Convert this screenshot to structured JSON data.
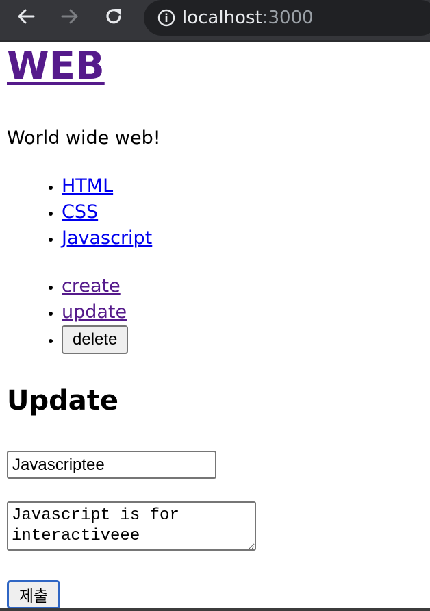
{
  "browser": {
    "url_host": "localhost",
    "url_port": ":3000",
    "icons": {
      "back": "back-arrow-icon",
      "forward": "forward-arrow-icon",
      "reload": "reload-icon",
      "info": "info-icon"
    }
  },
  "site": {
    "title": "WEB",
    "description": "World wide web!"
  },
  "topics": [
    {
      "label": "HTML"
    },
    {
      "label": "CSS"
    },
    {
      "label": "Javascript"
    }
  ],
  "controls": {
    "create_label": "create",
    "update_label": "update",
    "delete_label": "delete"
  },
  "form": {
    "heading": "Update",
    "title_value": "Javascriptee",
    "body_value": "Javascript is for interactiveee",
    "submit_label": "제출"
  },
  "colors": {
    "chrome_bg": "#35363a",
    "omnibox_bg": "#202124",
    "link": "#0000ee",
    "visited_link": "#551a8b",
    "focus_ring": "#2f66c4"
  }
}
